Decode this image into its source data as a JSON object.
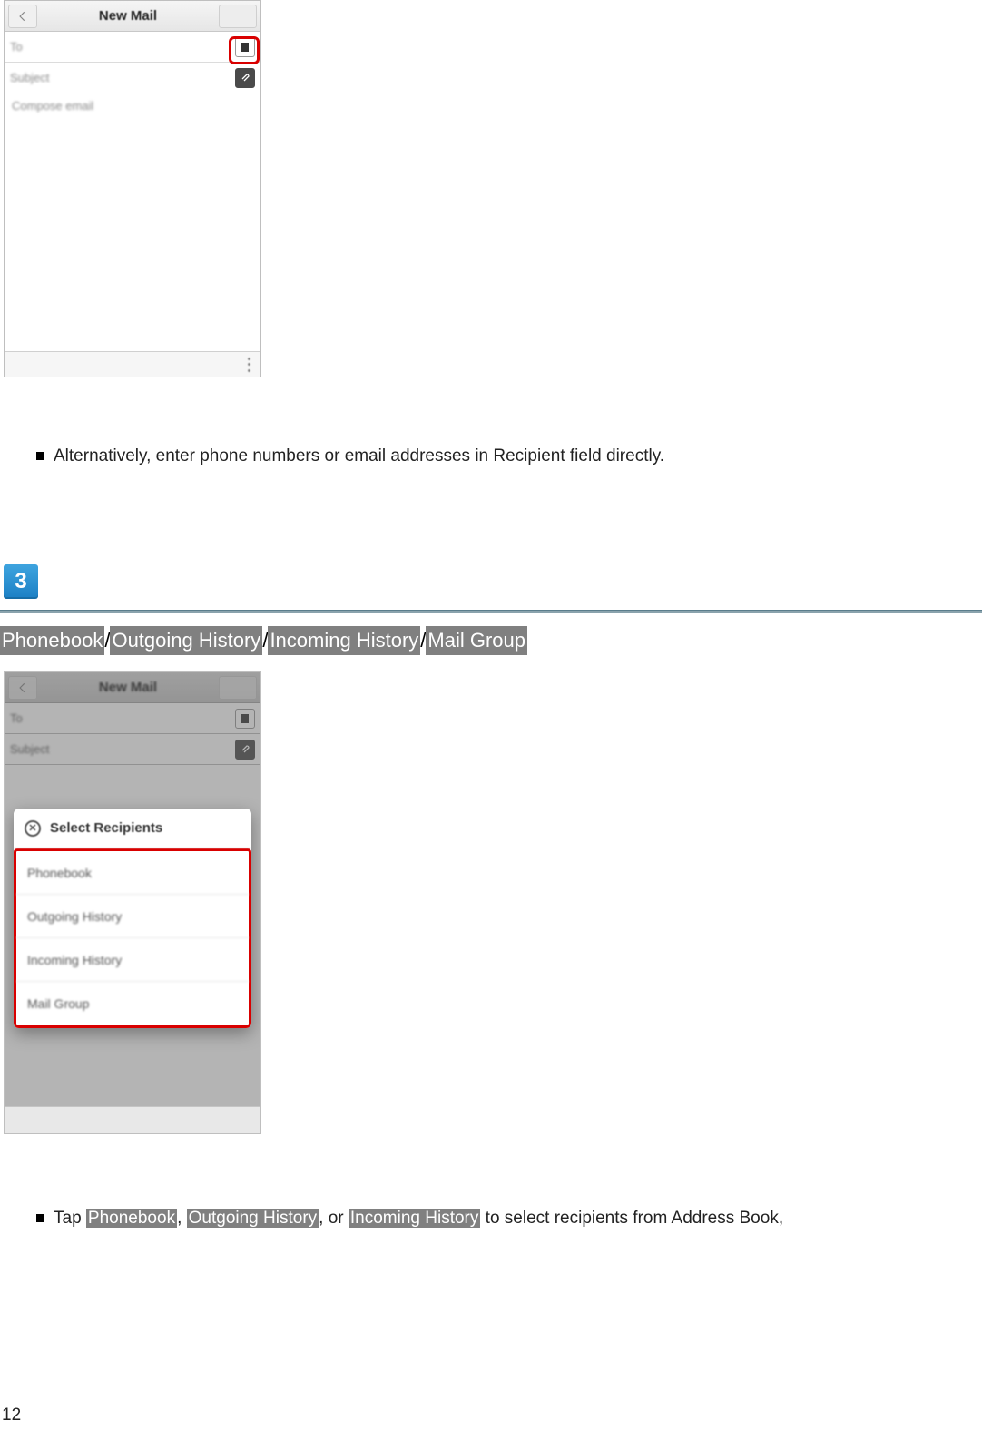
{
  "page_number": "12",
  "step_number": "3",
  "phone1": {
    "title": "New Mail",
    "to_label": "To",
    "subject_label": "Subject",
    "compose_placeholder": "Compose email"
  },
  "bullets": {
    "alt_entry": "Alternatively, enter phone numbers or email addresses in Recipient field directly.",
    "tap_prefix": "Tap ",
    "tap_mid1": ", ",
    "tap_mid2": ", or ",
    "tap_suffix": " to select recipients from Address Book,"
  },
  "menu": {
    "phonebook": "Phonebook",
    "outgoing": "Outgoing History",
    "incoming": "Incoming History",
    "mailgroup": "Mail Group"
  },
  "phone2": {
    "title": "New Mail",
    "to_label": "To",
    "subject_label": "Subject",
    "popup_title": "Select Recipients",
    "options": {
      "phonebook": "Phonebook",
      "outgoing": "Outgoing History",
      "incoming": "Incoming History",
      "mailgroup": "Mail Group"
    }
  }
}
